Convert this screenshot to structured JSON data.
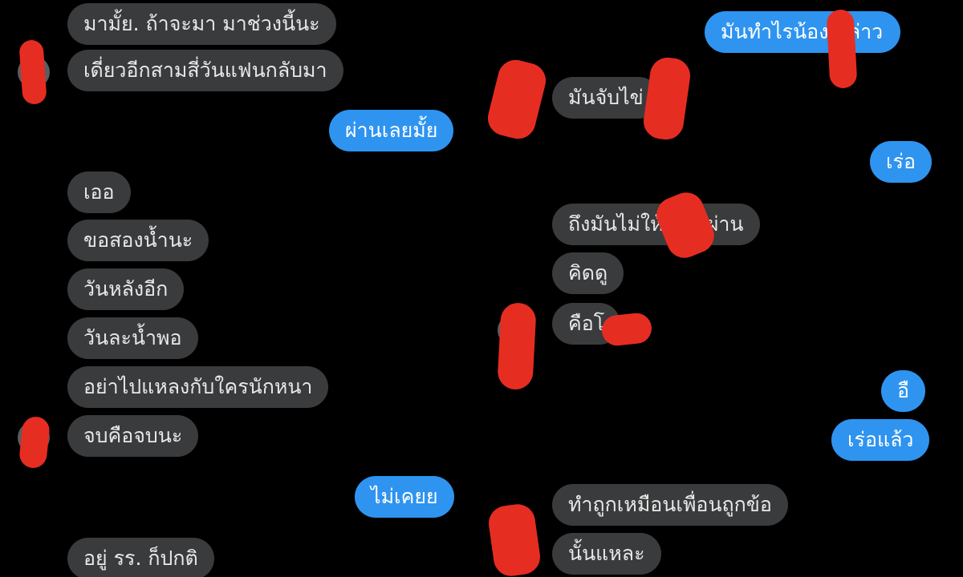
{
  "left_thread": {
    "messages": [
      {
        "text": "มามั้ย. ถ้าจะมา มาช่วงนี้นะ",
        "direction": "incoming"
      },
      {
        "text": "เดี่ยวอีกสามสี่วันแฟนกลับมา",
        "direction": "incoming"
      },
      {
        "text": "ผ่านเลยมั้ย",
        "direction": "outgoing"
      },
      {
        "text": "เออ",
        "direction": "incoming"
      },
      {
        "text": "ขอสองน้ำนะ",
        "direction": "incoming"
      },
      {
        "text": "วันหลังอีก",
        "direction": "incoming"
      },
      {
        "text": "วันละน้ำพอ",
        "direction": "incoming"
      },
      {
        "text": "อย่าไปแหลงกับใครนักหนา",
        "direction": "incoming"
      },
      {
        "text": "จบคือจบนะ",
        "direction": "incoming"
      },
      {
        "text": "ไม่เคยย",
        "direction": "outgoing"
      },
      {
        "text": "อยู่ รร. ก็ปกติ",
        "direction": "incoming"
      }
    ]
  },
  "right_thread": {
    "messages": [
      {
        "text": "มันทำไรน้อง หล่าว",
        "direction": "outgoing"
      },
      {
        "text": "มันจับไข่",
        "direction": "incoming"
      },
      {
        "text": "เร่อ",
        "direction": "outgoing"
      },
      {
        "text": "ถึงมันไม่ให้ สอบผ่าน",
        "direction": "incoming"
      },
      {
        "text": "คิดดู",
        "direction": "incoming"
      },
      {
        "text": "คือโ",
        "direction": "incoming"
      },
      {
        "text": "อื",
        "direction": "outgoing"
      },
      {
        "text": "เร่อแล้ว",
        "direction": "outgoing"
      },
      {
        "text": "ทำถูกเหมือนเพื่อนถูกข้อ",
        "direction": "incoming"
      },
      {
        "text": "นั้นแหละ",
        "direction": "incoming"
      }
    ]
  },
  "colors": {
    "background": "#000000",
    "incoming_bubble": "#3a3b3c",
    "outgoing_bubble": "#2e94f0",
    "redaction": "#e62d22"
  }
}
